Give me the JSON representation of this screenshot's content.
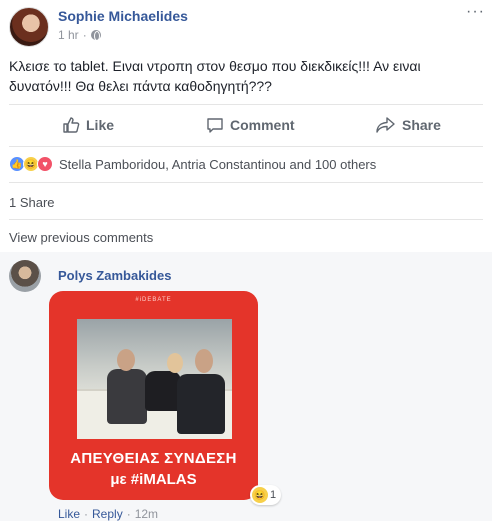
{
  "post": {
    "author": "Sophie Michaelides",
    "time": "1 hr",
    "privacy_separator": "·",
    "text": "Κλεισε το tablet. Ειναι ντροπη στον θεσμο που διεκδικείς!!! Αν ειναι δυνατόν!!! Θα θελει πάντα καθοδηγητή???"
  },
  "actions": {
    "like": "Like",
    "comment": "Comment",
    "share": "Share"
  },
  "reactions": {
    "names": "Stella Pamboridou, Antria Constantinou and 100 others",
    "types": [
      "like-icon",
      "haha-icon",
      "love-icon"
    ]
  },
  "shares": "1 Share",
  "view_previous": "View previous comments",
  "comment": {
    "author": "Polys Zambakides",
    "image": {
      "tag": "#iDEBATE",
      "title": "ΑΠΕΥΘΕΙΑΣ ΣΥΝΔΕΣΗ",
      "hashtag": "με #iMALAS",
      "bg_color": "#e4342a"
    },
    "reaction_count": "1",
    "like": "Like",
    "reply": "Reply",
    "sep": "·",
    "time": "12m"
  },
  "colors": {
    "link": "#365899",
    "muted": "#90949c",
    "action": "#606770"
  }
}
